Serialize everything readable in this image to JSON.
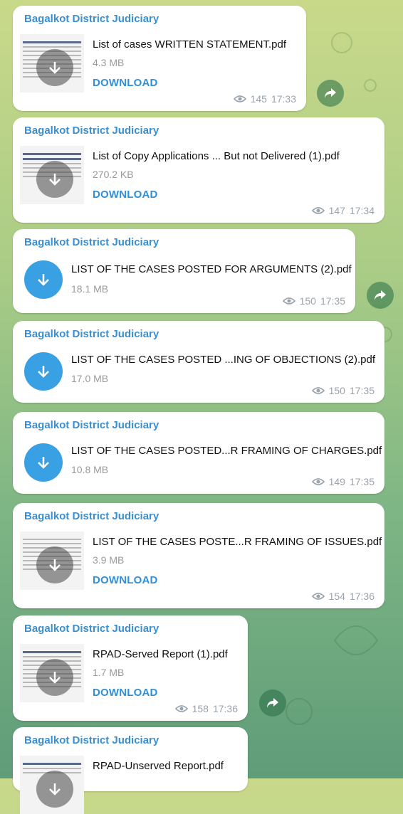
{
  "channel_name": "Bagalkot District Judiciary",
  "download_label": "DOWNLOAD",
  "accent": "#3aa0e4",
  "messages": [
    {
      "file": "List of cases  WRITTEN STATEMENT.pdf",
      "size": "4.3 MB",
      "views": "145",
      "time": "17:33",
      "kind": "thumb"
    },
    {
      "file": "List of Copy Applications ... But not Delivered (1).pdf",
      "size": "270.2 KB",
      "views": "147",
      "time": "17:34",
      "kind": "thumb"
    },
    {
      "file": "LIST OF THE CASES POSTED FOR ARGUMENTS (2).pdf",
      "size": "18.1 MB",
      "views": "150",
      "time": "17:35",
      "kind": "icon"
    },
    {
      "file": "LIST OF THE CASES POSTED ...ING OF OBJECTIONS (2).pdf",
      "size": "17.0 MB",
      "views": "150",
      "time": "17:35",
      "kind": "icon"
    },
    {
      "file": "LIST OF THE CASES POSTED...R FRAMING OF CHARGES.pdf",
      "size": "10.8 MB",
      "views": "149",
      "time": "17:35",
      "kind": "icon"
    },
    {
      "file": "LIST OF THE CASES POSTE...R FRAMING OF ISSUES.pdf",
      "size": "3.9 MB",
      "views": "154",
      "time": "17:36",
      "kind": "thumb"
    },
    {
      "file": "RPAD-Served Report (1).pdf",
      "size": "1.7 MB",
      "views": "158",
      "time": "17:36",
      "kind": "thumb"
    },
    {
      "file": "RPAD-Unserved Report.pdf",
      "kind": "thumb"
    }
  ]
}
